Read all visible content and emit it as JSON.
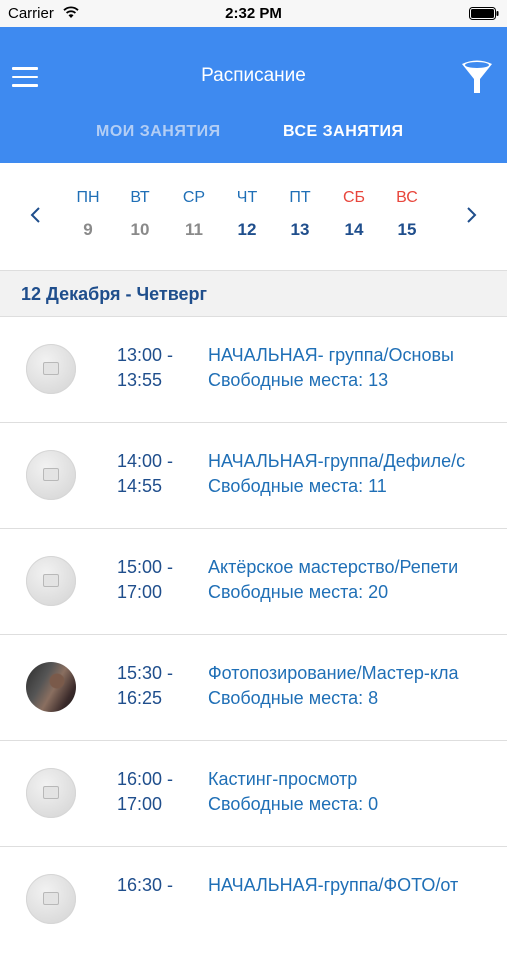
{
  "status_bar": {
    "carrier": "Carrier",
    "time": "2:32 PM"
  },
  "header": {
    "title": "Расписание",
    "tabs": [
      {
        "label": "МОИ ЗАНЯТИЯ",
        "active": false
      },
      {
        "label": "ВСЕ ЗАНЯТИЯ",
        "active": true
      }
    ],
    "color": "#3e8af0"
  },
  "week": {
    "days": [
      {
        "name": "ПН",
        "num": "9",
        "state": "past"
      },
      {
        "name": "ВТ",
        "num": "10",
        "state": "past"
      },
      {
        "name": "СР",
        "num": "11",
        "state": "past"
      },
      {
        "name": "ЧТ",
        "num": "12",
        "state": "current"
      },
      {
        "name": "ПТ",
        "num": "13",
        "state": "current"
      },
      {
        "name": "СБ",
        "num": "14",
        "state": "weekend"
      },
      {
        "name": "ВС",
        "num": "15",
        "state": "weekend"
      }
    ]
  },
  "date_header": "12 Декабря - Четверг",
  "schedule": [
    {
      "start": "13:00 -",
      "end": "13:55",
      "class": "НАЧАЛЬНАЯ- группа/Основы",
      "seats": "Свободные места: 13",
      "avatar": "placeholder"
    },
    {
      "start": "14:00 -",
      "end": "14:55",
      "class": "НАЧАЛЬНАЯ-группа/Дефиле/с",
      "seats": "Свободные места: 11",
      "avatar": "placeholder"
    },
    {
      "start": "15:00 -",
      "end": "17:00",
      "class": "Актёрское мастерство/Репети",
      "seats": "Свободные места: 20",
      "avatar": "placeholder"
    },
    {
      "start": "15:30 -",
      "end": "16:25",
      "class": "Фотопозирование/Мастер-кла",
      "seats": "Свободные места: 8",
      "avatar": "photo"
    },
    {
      "start": "16:00 -",
      "end": "17:00",
      "class": "Кастинг-просмотр",
      "seats": "Свободные места: 0",
      "avatar": "placeholder"
    },
    {
      "start": "16:30 -",
      "end": "",
      "class": "НАЧАЛЬНАЯ-группа/ФОТО/от",
      "seats": "",
      "avatar": "placeholder"
    }
  ]
}
